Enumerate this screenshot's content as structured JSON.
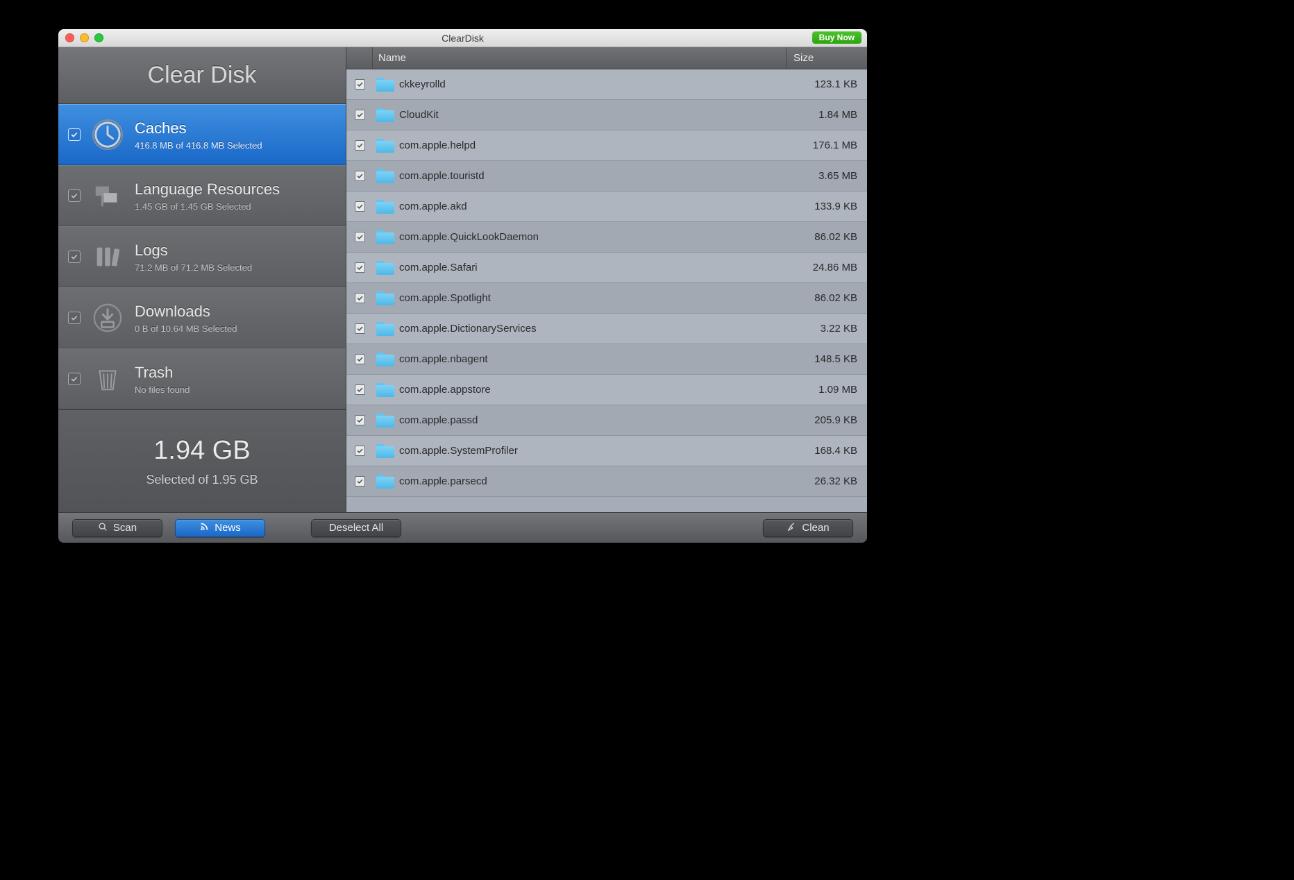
{
  "window": {
    "title": "ClearDisk",
    "buy_now": "Buy Now",
    "brand": "Clear Disk"
  },
  "sidebar": {
    "categories": [
      {
        "id": "caches",
        "title": "Caches",
        "subtitle": "416.8 MB of 416.8 MB Selected",
        "checked": true,
        "selected": true
      },
      {
        "id": "lang",
        "title": "Language Resources",
        "subtitle": "1.45 GB of 1.45 GB Selected",
        "checked": true,
        "selected": false
      },
      {
        "id": "logs",
        "title": "Logs",
        "subtitle": "71.2 MB of 71.2 MB Selected",
        "checked": true,
        "selected": false
      },
      {
        "id": "dl",
        "title": "Downloads",
        "subtitle": "0 B of 10.64 MB Selected",
        "checked": true,
        "selected": false
      },
      {
        "id": "trash",
        "title": "Trash",
        "subtitle": "No files found",
        "checked": true,
        "selected": false
      }
    ],
    "summary_big": "1.94 GB",
    "summary_sub": "Selected of 1.95 GB"
  },
  "table": {
    "headers": {
      "name": "Name",
      "size": "Size"
    },
    "rows": [
      {
        "name": "ckkeyrolld",
        "size": "123.1 KB",
        "checked": true
      },
      {
        "name": "CloudKit",
        "size": "1.84 MB",
        "checked": true
      },
      {
        "name": "com.apple.helpd",
        "size": "176.1 MB",
        "checked": true
      },
      {
        "name": "com.apple.touristd",
        "size": "3.65 MB",
        "checked": true
      },
      {
        "name": "com.apple.akd",
        "size": "133.9 KB",
        "checked": true
      },
      {
        "name": "com.apple.QuickLookDaemon",
        "size": "86.02 KB",
        "checked": true
      },
      {
        "name": "com.apple.Safari",
        "size": "24.86 MB",
        "checked": true
      },
      {
        "name": "com.apple.Spotlight",
        "size": "86.02 KB",
        "checked": true
      },
      {
        "name": "com.apple.DictionaryServices",
        "size": "3.22 KB",
        "checked": true
      },
      {
        "name": "com.apple.nbagent",
        "size": "148.5 KB",
        "checked": true
      },
      {
        "name": "com.apple.appstore",
        "size": "1.09 MB",
        "checked": true
      },
      {
        "name": "com.apple.passd",
        "size": "205.9 KB",
        "checked": true
      },
      {
        "name": "com.apple.SystemProfiler",
        "size": "168.4 KB",
        "checked": true
      },
      {
        "name": "com.apple.parsecd",
        "size": "26.32 KB",
        "checked": true
      }
    ]
  },
  "footer": {
    "scan": "Scan",
    "news": "News",
    "deselect": "Deselect All",
    "clean": "Clean"
  }
}
